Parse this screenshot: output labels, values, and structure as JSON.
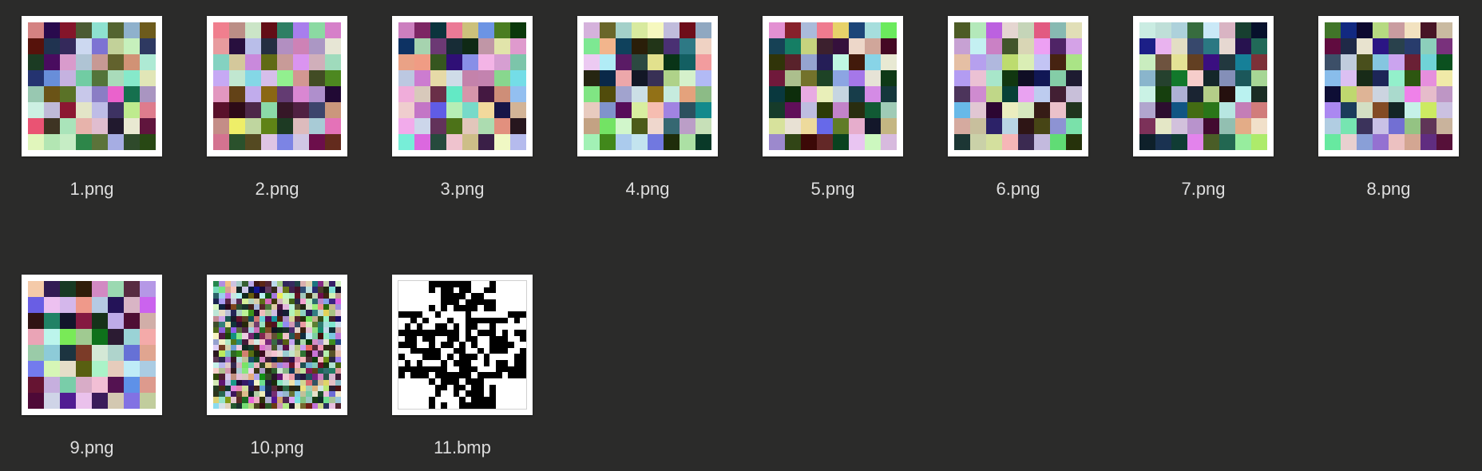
{
  "files": [
    {
      "name": "1.png",
      "type": "png",
      "grid": 8
    },
    {
      "name": "2.png",
      "type": "png",
      "grid": 8
    },
    {
      "name": "3.png",
      "type": "png",
      "grid": 8
    },
    {
      "name": "4.png",
      "type": "png",
      "grid": 8
    },
    {
      "name": "5.png",
      "type": "png",
      "grid": 8
    },
    {
      "name": "6.png",
      "type": "png",
      "grid": 8
    },
    {
      "name": "7.png",
      "type": "png",
      "grid": 8
    },
    {
      "name": "8.png",
      "type": "png",
      "grid": 8
    },
    {
      "name": "9.png",
      "type": "png",
      "grid": 8
    },
    {
      "name": "10.png",
      "type": "png",
      "grid": 22
    },
    {
      "name": "11.bmp",
      "type": "bmp",
      "grid": 21
    }
  ],
  "colors": {
    "background": "#2b2b2a",
    "label": "#dedede",
    "frame": "#ffffff"
  }
}
